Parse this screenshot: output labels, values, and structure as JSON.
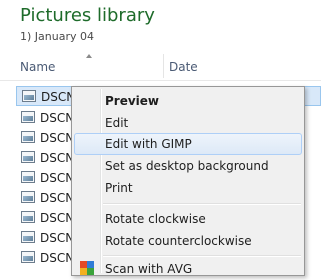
{
  "library": {
    "title": "Pictures library",
    "subtitle": "1) January 04"
  },
  "columns": {
    "name": "Name",
    "date": "Date"
  },
  "files": [
    "DSCN",
    "DSCN",
    "DSCN",
    "DSCN",
    "DSCN",
    "DSCN",
    "DSCN",
    "DSCN",
    "DSCN"
  ],
  "context_menu": {
    "items": [
      {
        "label": "Preview",
        "default": true
      },
      {
        "label": "Edit"
      },
      {
        "label": "Edit with GIMP"
      },
      {
        "label": "Set as desktop background"
      },
      {
        "label": "Print"
      },
      {
        "label": "Rotate clockwise"
      },
      {
        "label": "Rotate counterclockwise"
      },
      {
        "label": "Scan with AVG"
      }
    ],
    "hovered_item": "Edit with GIMP"
  },
  "colors": {
    "title_green": "#1e6b2a",
    "selection": "#d8e8f9",
    "menu_bg": "#f0f0f0"
  }
}
